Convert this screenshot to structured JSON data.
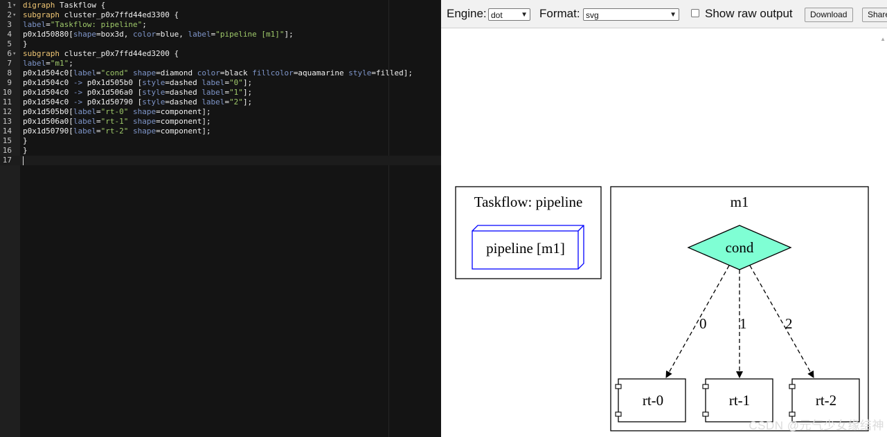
{
  "editor": {
    "lines": [
      {
        "n": "1",
        "fold": true,
        "tokens": [
          [
            "kw",
            "digraph"
          ],
          [
            "pl",
            " Taskflow {"
          ]
        ]
      },
      {
        "n": "2",
        "fold": true,
        "tokens": [
          [
            "kw",
            "subgraph"
          ],
          [
            "pl",
            " cluster_p0x7ffd44ed3300 {"
          ]
        ]
      },
      {
        "n": "3",
        "fold": false,
        "tokens": [
          [
            "at",
            "label"
          ],
          [
            "pl",
            "="
          ],
          [
            "st",
            "\"Taskflow: pipeline\""
          ],
          [
            "pl",
            ";"
          ]
        ]
      },
      {
        "n": "4",
        "fold": false,
        "tokens": [
          [
            "pl",
            "p0x1d50880["
          ],
          [
            "at",
            "shape"
          ],
          [
            "pl",
            "=box3d, "
          ],
          [
            "at",
            "color"
          ],
          [
            "pl",
            "=blue, "
          ],
          [
            "at",
            "label"
          ],
          [
            "pl",
            "="
          ],
          [
            "st",
            "\"pipeline [m1]\""
          ],
          [
            "pl",
            "];"
          ]
        ]
      },
      {
        "n": "5",
        "fold": false,
        "tokens": [
          [
            "pl",
            "}"
          ]
        ]
      },
      {
        "n": "6",
        "fold": true,
        "tokens": [
          [
            "kw",
            "subgraph"
          ],
          [
            "pl",
            " cluster_p0x7ffd44ed3200 {"
          ]
        ]
      },
      {
        "n": "7",
        "fold": false,
        "tokens": [
          [
            "at",
            "label"
          ],
          [
            "pl",
            "="
          ],
          [
            "st",
            "\"m1\""
          ],
          [
            "pl",
            ";"
          ]
        ]
      },
      {
        "n": "8",
        "fold": false,
        "tokens": [
          [
            "pl",
            "p0x1d504c0["
          ],
          [
            "at",
            "label"
          ],
          [
            "pl",
            "="
          ],
          [
            "st",
            "\"cond\""
          ],
          [
            "pl",
            " "
          ],
          [
            "at",
            "shape"
          ],
          [
            "pl",
            "=diamond "
          ],
          [
            "at",
            "color"
          ],
          [
            "pl",
            "=black "
          ],
          [
            "at",
            "fillcolor"
          ],
          [
            "pl",
            "=aquamarine "
          ],
          [
            "at",
            "style"
          ],
          [
            "pl",
            "=filled];"
          ]
        ]
      },
      {
        "n": "9",
        "fold": false,
        "tokens": [
          [
            "pl",
            "p0x1d504c0 "
          ],
          [
            "ar",
            "->"
          ],
          [
            "pl",
            " p0x1d505b0 ["
          ],
          [
            "at",
            "style"
          ],
          [
            "pl",
            "=dashed "
          ],
          [
            "at",
            "label"
          ],
          [
            "pl",
            "="
          ],
          [
            "st",
            "\"0\""
          ],
          [
            "pl",
            "];"
          ]
        ]
      },
      {
        "n": "10",
        "fold": false,
        "tokens": [
          [
            "pl",
            "p0x1d504c0 "
          ],
          [
            "ar",
            "->"
          ],
          [
            "pl",
            " p0x1d506a0 ["
          ],
          [
            "at",
            "style"
          ],
          [
            "pl",
            "=dashed "
          ],
          [
            "at",
            "label"
          ],
          [
            "pl",
            "="
          ],
          [
            "st",
            "\"1\""
          ],
          [
            "pl",
            "];"
          ]
        ]
      },
      {
        "n": "11",
        "fold": false,
        "tokens": [
          [
            "pl",
            "p0x1d504c0 "
          ],
          [
            "ar",
            "->"
          ],
          [
            "pl",
            " p0x1d50790 ["
          ],
          [
            "at",
            "style"
          ],
          [
            "pl",
            "=dashed "
          ],
          [
            "at",
            "label"
          ],
          [
            "pl",
            "="
          ],
          [
            "st",
            "\"2\""
          ],
          [
            "pl",
            "];"
          ]
        ]
      },
      {
        "n": "12",
        "fold": false,
        "tokens": [
          [
            "pl",
            "p0x1d505b0["
          ],
          [
            "at",
            "label"
          ],
          [
            "pl",
            "="
          ],
          [
            "st",
            "\"rt-0\""
          ],
          [
            "pl",
            " "
          ],
          [
            "at",
            "shape"
          ],
          [
            "pl",
            "=component];"
          ]
        ]
      },
      {
        "n": "13",
        "fold": false,
        "tokens": [
          [
            "pl",
            "p0x1d506a0["
          ],
          [
            "at",
            "label"
          ],
          [
            "pl",
            "="
          ],
          [
            "st",
            "\"rt-1\""
          ],
          [
            "pl",
            " "
          ],
          [
            "at",
            "shape"
          ],
          [
            "pl",
            "=component];"
          ]
        ]
      },
      {
        "n": "14",
        "fold": false,
        "tokens": [
          [
            "pl",
            "p0x1d50790["
          ],
          [
            "at",
            "label"
          ],
          [
            "pl",
            "="
          ],
          [
            "st",
            "\"rt-2\""
          ],
          [
            "pl",
            " "
          ],
          [
            "at",
            "shape"
          ],
          [
            "pl",
            "=component];"
          ]
        ]
      },
      {
        "n": "15",
        "fold": false,
        "tokens": [
          [
            "pl",
            "}"
          ]
        ]
      },
      {
        "n": "16",
        "fold": false,
        "tokens": [
          [
            "pl",
            "}"
          ]
        ]
      },
      {
        "n": "17",
        "fold": false,
        "tokens": []
      }
    ]
  },
  "toolbar": {
    "engine_label": "Engine:",
    "engine_value": "dot",
    "format_label": "Format:",
    "format_value": "svg",
    "raw_output_label": "Show raw output",
    "raw_output_checked": false,
    "download_label": "Download",
    "share_label": "Share"
  },
  "graph": {
    "cluster1_label": "Taskflow: pipeline",
    "pipeline_node": "pipeline [m1]",
    "cluster2_label": "m1",
    "cond_node": "cond",
    "edge_labels": [
      "0",
      "1",
      "2"
    ],
    "rt_nodes": [
      "rt-0",
      "rt-1",
      "rt-2"
    ],
    "cond_fill": "#7fffd4",
    "pipeline_color": "#0000ff"
  },
  "watermark": "CSDN @元气少女缘结神"
}
